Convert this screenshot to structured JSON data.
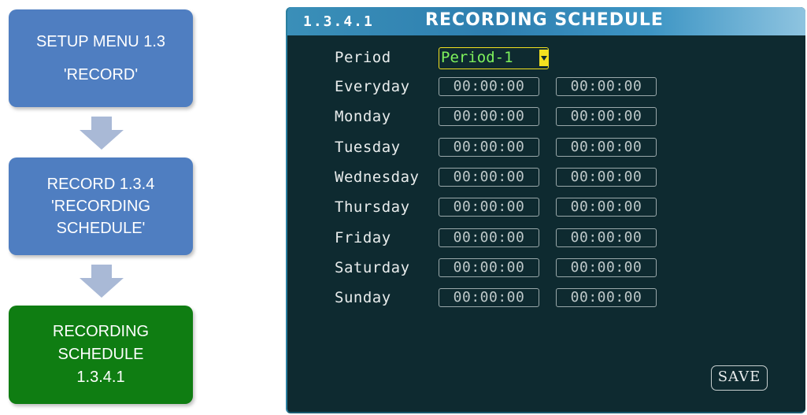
{
  "flow": {
    "step1": {
      "line1": "SETUP MENU 1.3",
      "line2": "'RECORD'"
    },
    "step2": {
      "line1": "RECORD 1.3.4",
      "line2": "'RECORDING",
      "line3": "SCHEDULE'"
    },
    "step3": {
      "line1": "RECORDING",
      "line2": "SCHEDULE",
      "line3": "1.3.4.1"
    },
    "colors": {
      "blue": "#4f7ec1",
      "green": "#0f7d12",
      "arrow": "#a9b9d6"
    }
  },
  "screen": {
    "title_number": "1.3.4.1",
    "title": "RECORDING SCHEDULE",
    "period_label": "Period",
    "period_value": "Period-1",
    "rows": [
      {
        "day": "Everyday",
        "start": "00:00:00",
        "end": "00:00:00"
      },
      {
        "day": "Monday",
        "start": "00:00:00",
        "end": "00:00:00"
      },
      {
        "day": "Tuesday",
        "start": "00:00:00",
        "end": "00:00:00"
      },
      {
        "day": "Wednesday",
        "start": "00:00:00",
        "end": "00:00:00"
      },
      {
        "day": "Thursday",
        "start": "00:00:00",
        "end": "00:00:00"
      },
      {
        "day": "Friday",
        "start": "00:00:00",
        "end": "00:00:00"
      },
      {
        "day": "Saturday",
        "start": "00:00:00",
        "end": "00:00:00"
      },
      {
        "day": "Sunday",
        "start": "00:00:00",
        "end": "00:00:00"
      }
    ],
    "save_label": "SAVE",
    "colors": {
      "background": "#0e2a30",
      "title_bar": "#3a8fb8",
      "highlight": "#f2e020",
      "selected_text": "#7ef25c"
    }
  }
}
